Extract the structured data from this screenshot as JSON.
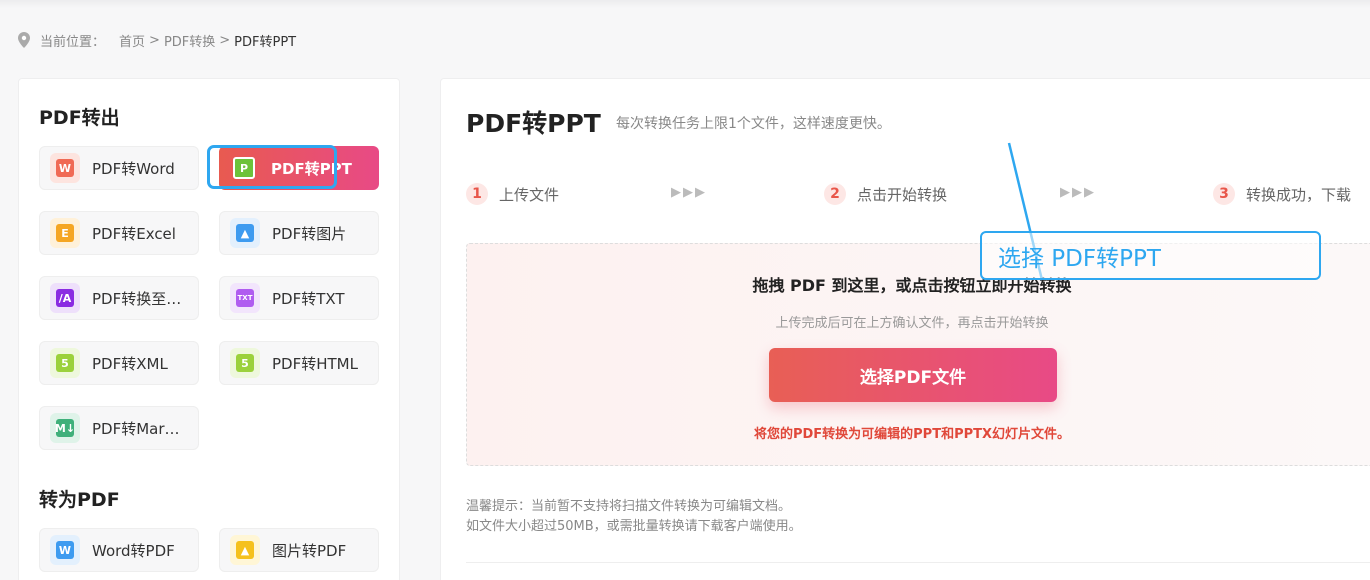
{
  "breadcrumb": {
    "prefix": "当前位置：",
    "home": "首页",
    "sep": ">",
    "category": "PDF转换",
    "current": "PDF转PPT"
  },
  "sidebar": {
    "export_title": "PDF转出",
    "export_tools": [
      {
        "label": "PDF转Word",
        "icon": "word-icon",
        "chip": "W",
        "color": "#f06a55",
        "bg": "#fde4df"
      },
      {
        "label": "PDF转PPT",
        "icon": "ppt-icon",
        "chip": "P",
        "color": "#6dc23a",
        "bg": "#ffffff",
        "active": true
      },
      {
        "label": "PDF转Excel",
        "icon": "excel-icon",
        "chip": "E",
        "color": "#f5a623",
        "bg": "#fff1d9"
      },
      {
        "label": "PDF转图片",
        "icon": "image-icon",
        "chip": "▲",
        "color": "#3d9bf0",
        "bg": "#e3f0fd"
      },
      {
        "label": "PDF转换至…",
        "icon": "pdfa-icon",
        "chip": "/A",
        "color": "#8a2be2",
        "bg": "#eee0fb"
      },
      {
        "label": "PDF转TXT",
        "icon": "txt-icon",
        "chip": "TXT",
        "color": "#b05cf0",
        "bg": "#f2e5fc"
      },
      {
        "label": "PDF转XML",
        "icon": "xml-icon",
        "chip": "5",
        "color": "#9bd13c",
        "bg": "#eef8dc"
      },
      {
        "label": "PDF转HTML",
        "icon": "html-icon",
        "chip": "5",
        "color": "#9bd13c",
        "bg": "#eef8dc"
      },
      {
        "label": "PDF转Mar…",
        "icon": "markdown-icon",
        "chip": "M↓",
        "color": "#3fb07a",
        "bg": "#dff3e9"
      }
    ],
    "import_title": "转为PDF",
    "import_tools": [
      {
        "label": "Word转PDF",
        "icon": "word-icon",
        "chip": "W",
        "color": "#3d9bf0",
        "bg": "#e3f0fd"
      },
      {
        "label": "图片转PDF",
        "icon": "image-icon",
        "chip": "▲",
        "color": "#f5c11d",
        "bg": "#fff6d6"
      }
    ]
  },
  "main": {
    "title": "PDF转PPT",
    "subtitle": "每次转换任务上限1个文件，这样速度更快。",
    "steps": [
      {
        "num": "1",
        "label": "上传文件"
      },
      {
        "num": "2",
        "label": "点击开始转换"
      },
      {
        "num": "3",
        "label": "转换成功，下载"
      }
    ],
    "step_arrows": "▶▶▶",
    "dropzone": {
      "title": "拖拽 PDF 到这里，或点击按钮立即开始转换",
      "hint": "上传完成后可在上方确认文件，再点击开始转换",
      "button": "选择PDF文件",
      "note": "将您的PDF转换为可编辑的PPT和PPTX幻灯片文件。"
    },
    "tips_line1": "温馨提示：当前暂不支持将扫描文件转换为可编辑文档。",
    "tips_line2": "如文件大小超过50MB，或需批量转换请下载客户端使用。"
  },
  "annotation": {
    "label": "选择 PDF转PPT",
    "color": "#2ea7f0"
  }
}
